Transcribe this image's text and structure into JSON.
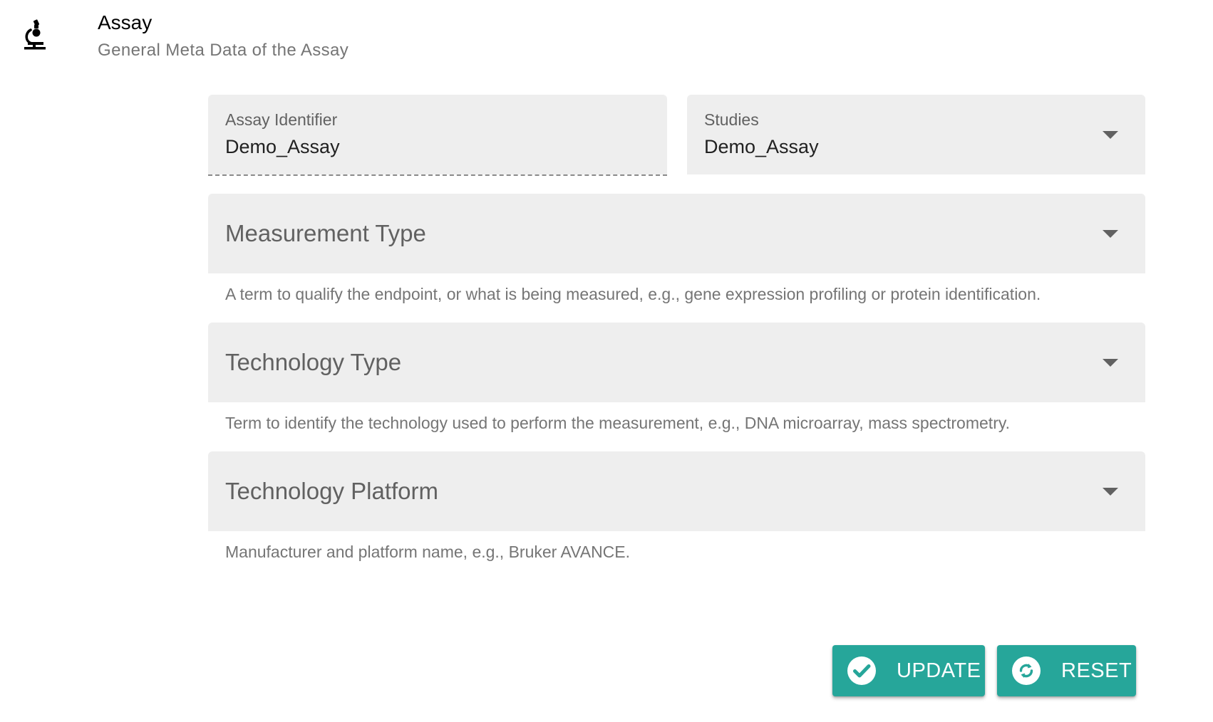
{
  "header": {
    "icon": "microscope-icon",
    "title": "Assay",
    "subtitle": "General Meta Data of the Assay"
  },
  "form": {
    "assay_identifier": {
      "label": "Assay Identifier",
      "value": "Demo_Assay"
    },
    "studies": {
      "label": "Studies",
      "value": "Demo_Assay"
    },
    "measurement_type": {
      "label": "Measurement Type",
      "hint": "A term to qualify the endpoint, or what is being measured, e.g., gene expression profiling or protein identification."
    },
    "technology_type": {
      "label": "Technology Type",
      "hint": "Term to identify the technology used to perform the measurement, e.g., DNA microarray, mass spectrometry."
    },
    "technology_platform": {
      "label": "Technology Platform",
      "hint": "Manufacturer and platform name, e.g., Bruker AVANCE."
    }
  },
  "actions": {
    "update": {
      "label": "UPDATE",
      "icon": "check-circle-icon"
    },
    "reset": {
      "label": "RESET",
      "icon": "sync-circle-icon"
    }
  },
  "colors": {
    "accent": "#26a69a",
    "field_background": "#eeeeee",
    "hint_text": "#757575"
  }
}
